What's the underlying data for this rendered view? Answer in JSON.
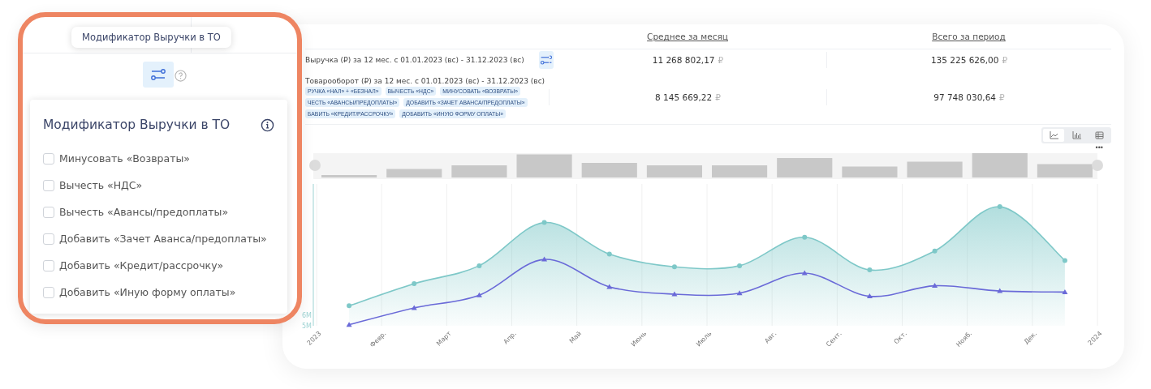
{
  "tooltip": {
    "text": "Модификатор Выручки в ТО"
  },
  "modifier_menu": {
    "title": "Модификатор Выручки в ТО",
    "options": [
      {
        "label": "Минусовать «Возвраты»",
        "checked": false
      },
      {
        "label": "Вычесть «НДС»",
        "checked": false
      },
      {
        "label": "Вычесть «Авансы/предоплаты»",
        "checked": false
      },
      {
        "label": "Добавить «Зачет Аванса/предоплаты»",
        "checked": false
      },
      {
        "label": "Добавить «Кредит/рассрочку»",
        "checked": false
      },
      {
        "label": "Добавить «Иную форму оплаты»",
        "checked": false
      }
    ]
  },
  "table": {
    "columns": [
      "Среднее за месяц",
      "Всего за период"
    ],
    "rows": [
      {
        "kind": "filter",
        "label": "Выручка (₽) за 12 мес. с 01.01.2023 (вс) - 31.12.2023 (вс)",
        "average": "11 268 802,17",
        "average_currency": "₽",
        "total": "135 225 626,00",
        "total_currency": "₽"
      },
      {
        "kind": "tags",
        "label": "Товарооборот (₽) за 12 мес. с 01.01.2023 (вс) - 31.12.2023 (вс)",
        "tag_lines": [
          [
            "РУЧКА «НАЛ» + «БЕЗНАЛ»",
            "ВЫЧЕСТЬ «НДС»",
            "МИНУСОВАТЬ «ВОЗВРАТЫ»"
          ],
          [
            "ЧЕСТЬ «АВАНСЫ/ПРЕДОПЛАТЫ»",
            "ДОБАВИТЬ «ЗАЧЕТ АВАНСА/ПРЕДОПЛАТЫ»"
          ],
          [
            "БАВИТЬ «КРЕДИТ/РАССРОЧКУ»",
            "ДОБАВИТЬ «ИНУЮ ФОРМУ ОПЛАТЫ»"
          ]
        ],
        "average": "8 145 669,22",
        "average_currency": "₽",
        "total": "97 748 030,64",
        "total_currency": "₽"
      }
    ]
  },
  "chart_toolbar": {
    "views": [
      {
        "kind": "line",
        "selected": true
      },
      {
        "kind": "bar",
        "selected": false
      },
      {
        "kind": "table",
        "selected": false
      }
    ],
    "menu": "•••"
  },
  "chart": {
    "y_labels": [
      "6M",
      "5M"
    ],
    "x_labels": [
      "2023",
      "Февр.",
      "Март",
      "Апр.",
      "Май",
      "Июнь",
      "Июль",
      "Авг.",
      "Сент.",
      "Окт.",
      "Нояб.",
      "Дек.",
      "2024"
    ]
  }
}
